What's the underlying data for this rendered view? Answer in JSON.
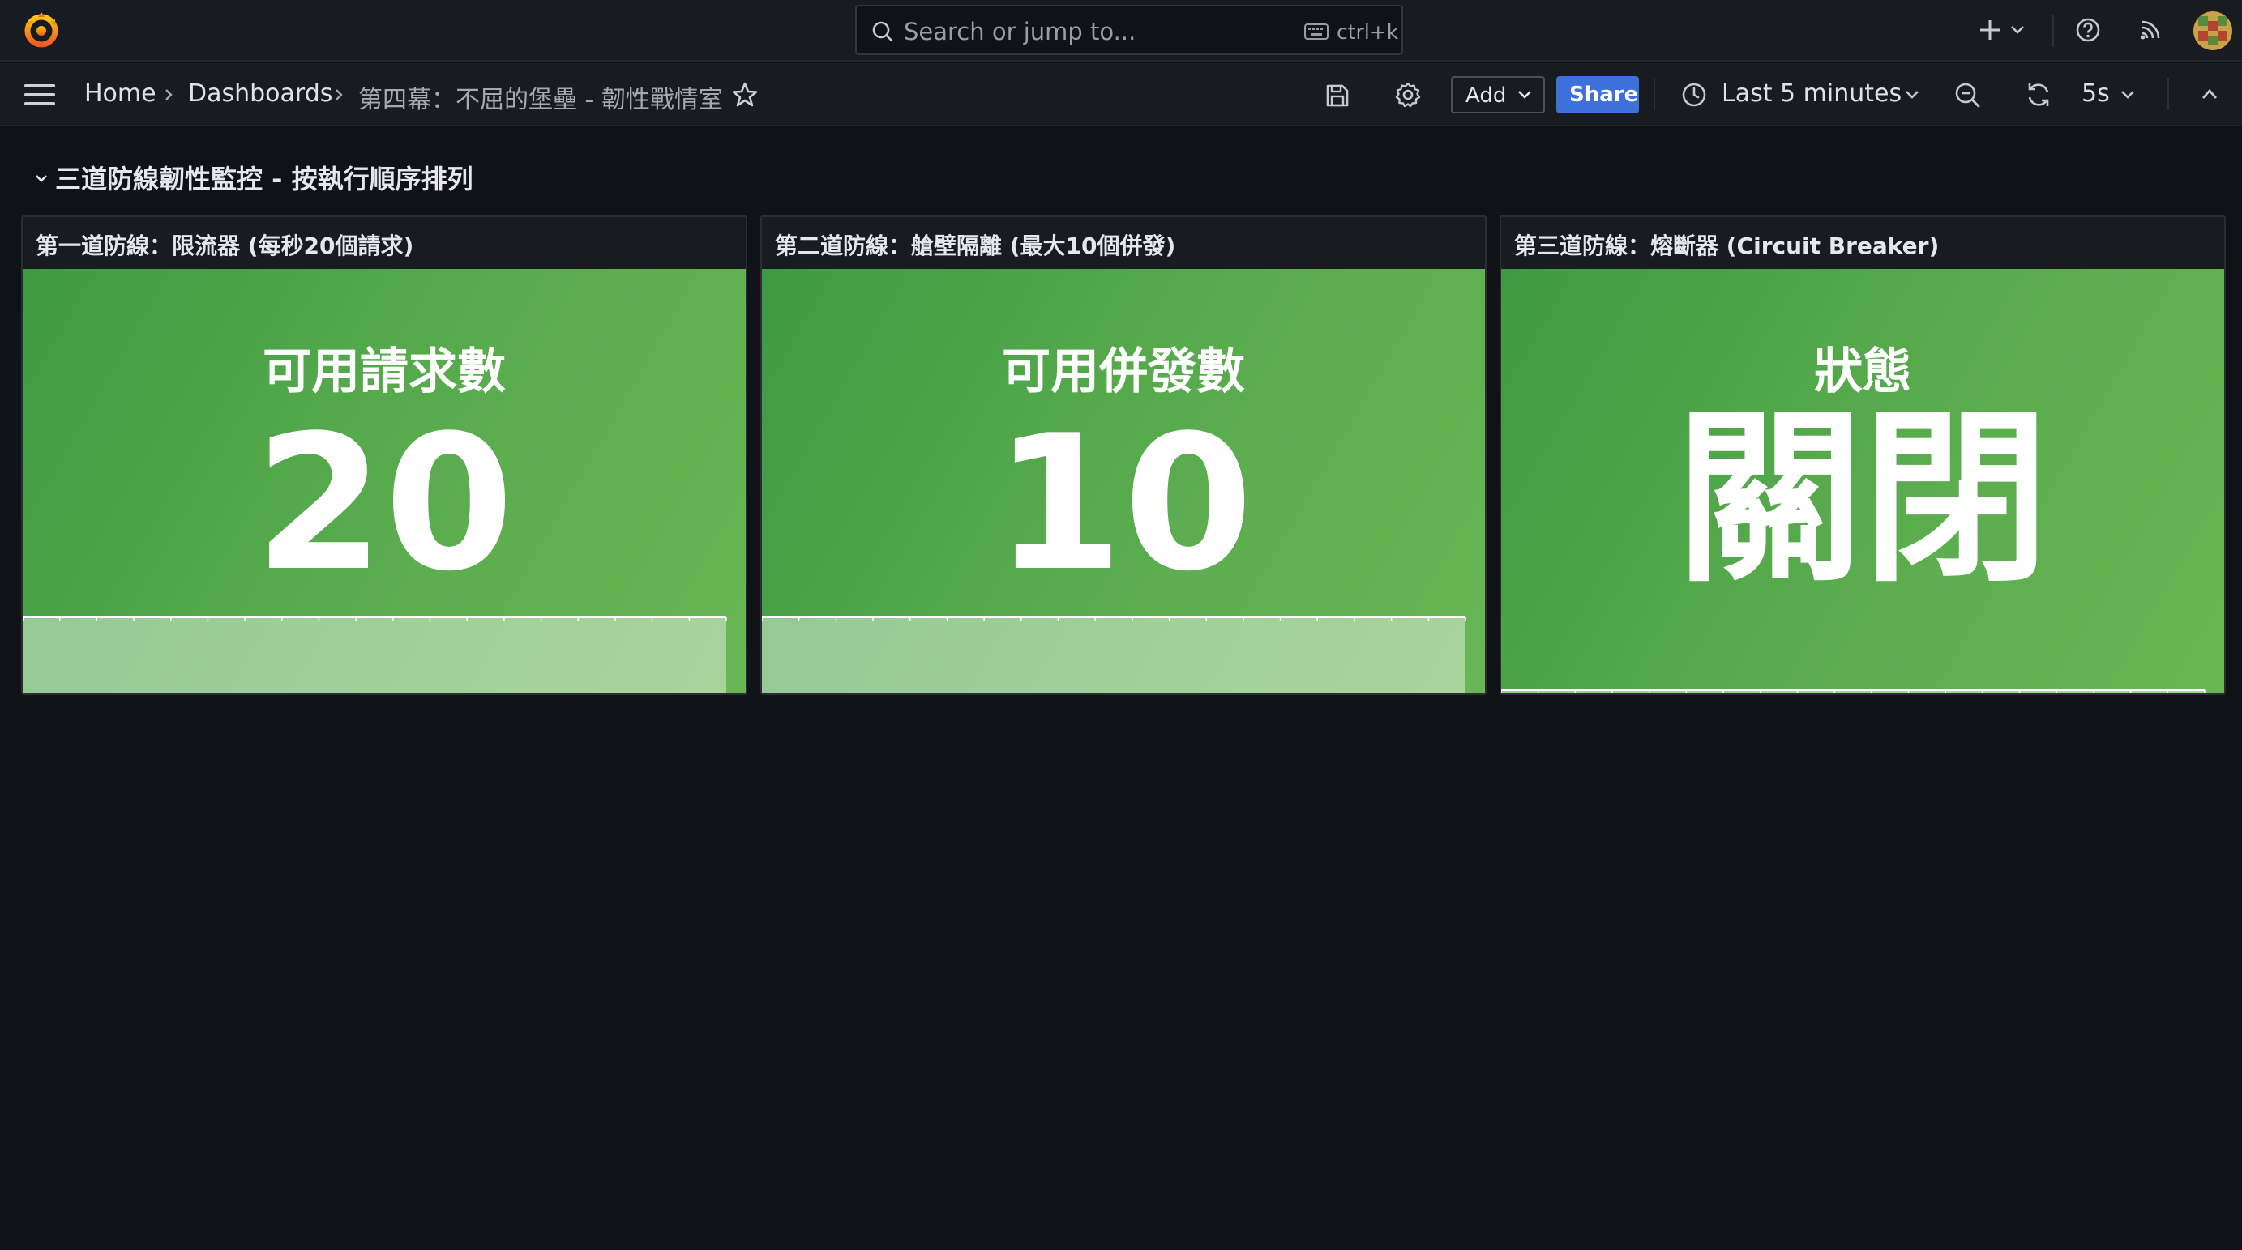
{
  "app": {
    "search_placeholder": "Search or jump to...",
    "search_shortcut": "ctrl+k"
  },
  "breadcrumb": [
    {
      "label": "Home"
    },
    {
      "label": "Dashboards"
    },
    {
      "label": "第四幕：不屈的堡壘 - 韌性戰情室"
    }
  ],
  "toolbar": {
    "add_label": "Add",
    "share_label": "Share",
    "time_range": "Last 5 minutes",
    "refresh_interval": "5s"
  },
  "row": {
    "title": "三道防線韌性監控 - 按執行順序排列"
  },
  "panels": [
    {
      "title": "第一道防線：限流器 (每秒20個請求)",
      "label": "可用請求數",
      "value": "20",
      "spark_level": 1.0
    },
    {
      "title": "第二道防線：艙壁隔離 (最大10個併發)",
      "label": "可用併發數",
      "value": "10",
      "spark_level": 1.0
    },
    {
      "title": "第三道防線：熔斷器 (Circuit Breaker)",
      "label": "狀態",
      "value": "關閉",
      "spark_level": 0.0
    }
  ],
  "colors": {
    "stat_green": "#56aa4c",
    "share_blue": "#3d71d9",
    "background": "#111217"
  }
}
